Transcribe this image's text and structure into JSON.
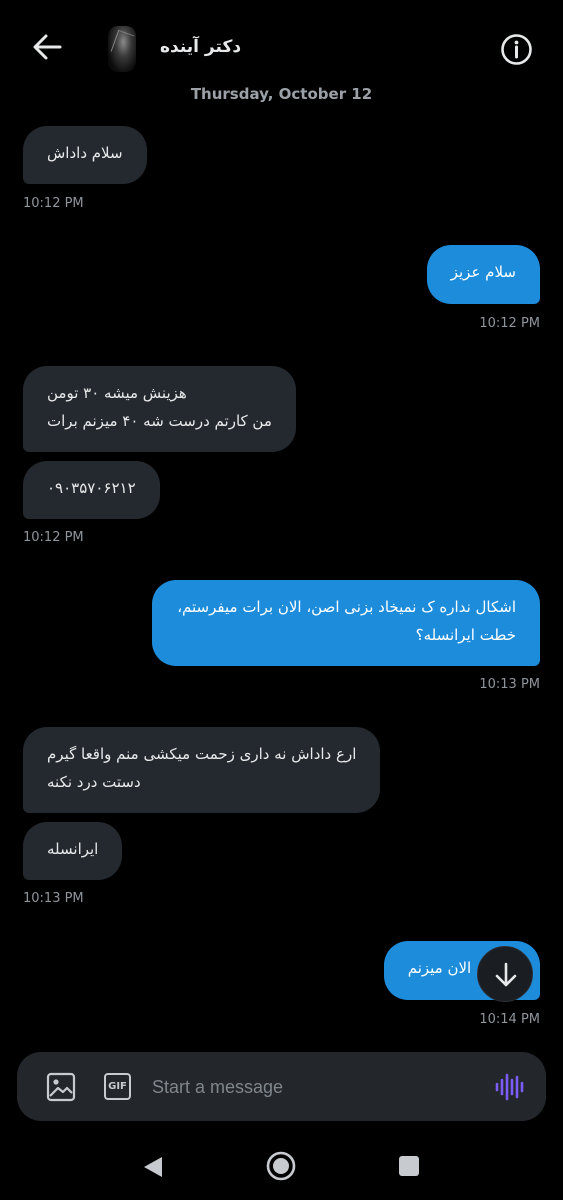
{
  "header": {
    "title": "دکتر آینده"
  },
  "date_separator": "Thursday, October 12",
  "messages": [
    {
      "side": "in",
      "lines": [
        "سلام داداش"
      ]
    },
    {
      "time": "10:12 PM"
    },
    {
      "side": "out",
      "lines": [
        "سلام عزیز"
      ]
    },
    {
      "time": "10:12 PM"
    },
    {
      "side": "in",
      "lines": [
        "هزینش میشه ۳۰ تومن",
        "من کارتم درست شه ۴۰ میزنم برات"
      ]
    },
    {
      "side": "in",
      "lines": [
        "۰۹۰۳۵۷۰۶۲۱۲"
      ]
    },
    {
      "time": "10:12 PM"
    },
    {
      "side": "out",
      "lines": [
        "اشکال نداره ک نمیخاد بزنی اصن، الان برات میفرستم،",
        "خطت ایرانسله؟"
      ]
    },
    {
      "time": "10:13 PM"
    },
    {
      "side": "in",
      "lines": [
        "ارع داداش نه داری زحمت میکشی منم واقعا گیرم",
        "دستت درد نکنه"
      ]
    },
    {
      "side": "in",
      "lines": [
        "ایرانسله"
      ]
    },
    {
      "time": "10:13 PM"
    },
    {
      "side": "out",
      "lines": [
        "داداش الان میزنم"
      ]
    },
    {
      "time": "10:14 PM"
    }
  ],
  "composer": {
    "placeholder": "Start a message",
    "gif_label": "GIF"
  },
  "icons": {
    "back": "arrow-left-icon",
    "info": "info-icon",
    "scroll": "arrow-down-icon",
    "image": "image-icon",
    "gif": "gif-icon",
    "voice": "voice-waveform-icon",
    "nav_back": "triangle-back-icon",
    "nav_home": "circle-home-icon",
    "nav_recents": "square-recents-icon"
  },
  "colors": {
    "background": "#000000",
    "incoming_bubble": "#24292f",
    "outgoing_bubble": "#1d8cdb",
    "voice_accent": "#7b5cf5"
  }
}
